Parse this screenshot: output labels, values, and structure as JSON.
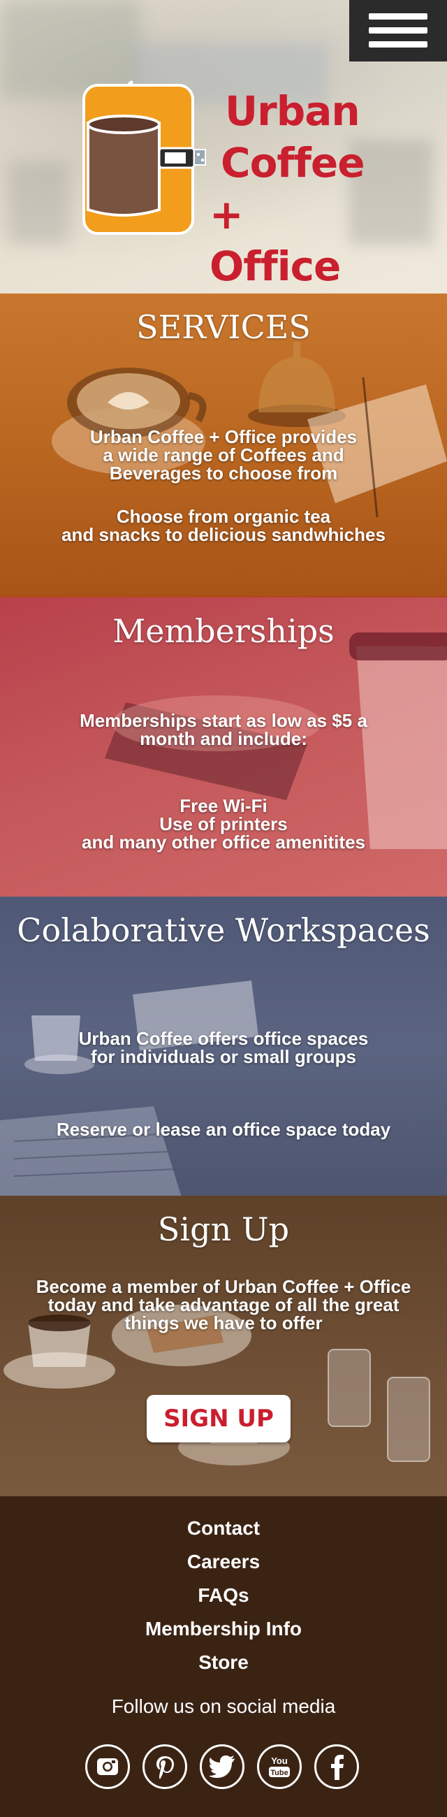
{
  "header": {
    "menu_icon": "hamburger-menu-icon",
    "logo_icon": "coffee-cup-usb-icon",
    "logo_lines": [
      "Urban",
      "Coffee",
      "+ Office"
    ],
    "brand_color": "#c91f2e"
  },
  "services": {
    "title": "SERVICES",
    "p1": [
      "Urban Coffee + Office provides",
      "a wide range of Coffees and",
      "Beverages to choose from"
    ],
    "p2": [
      "Choose from organic tea",
      "and snacks to delicious sandwhiches"
    ],
    "overlay_color": "#c07028"
  },
  "memberships": {
    "title": "Memberships",
    "p1": [
      "Memberships start as low as $5 a",
      "month and include:"
    ],
    "p2": [
      "Free Wi-Fi",
      "Use of printers",
      "and many other office amenitites"
    ],
    "overlay_color": "#c4575a"
  },
  "workspaces": {
    "title": "Colaborative Workspaces",
    "p1": [
      "Urban Coffee offers office spaces",
      "for individuals or small groups"
    ],
    "p2": [
      "Reserve or lease an office space today"
    ],
    "overlay_color": "#565f7c"
  },
  "signup": {
    "title": "Sign Up",
    "p1": [
      "Become a member of Urban Coffee + Office",
      "today and take advantage of all the great",
      "things we have to offer"
    ],
    "button_label": "SIGN UP",
    "overlay_color": "#6a4b30"
  },
  "footer": {
    "links": [
      "Contact",
      "Careers",
      "FAQs",
      "Membership Info",
      "Store"
    ],
    "follow_text": "Follow us on social media",
    "social_icons": [
      "instagram-icon",
      "pinterest-icon",
      "twitter-icon",
      "youtube-icon",
      "facebook-icon"
    ],
    "background": "#3b2314"
  }
}
